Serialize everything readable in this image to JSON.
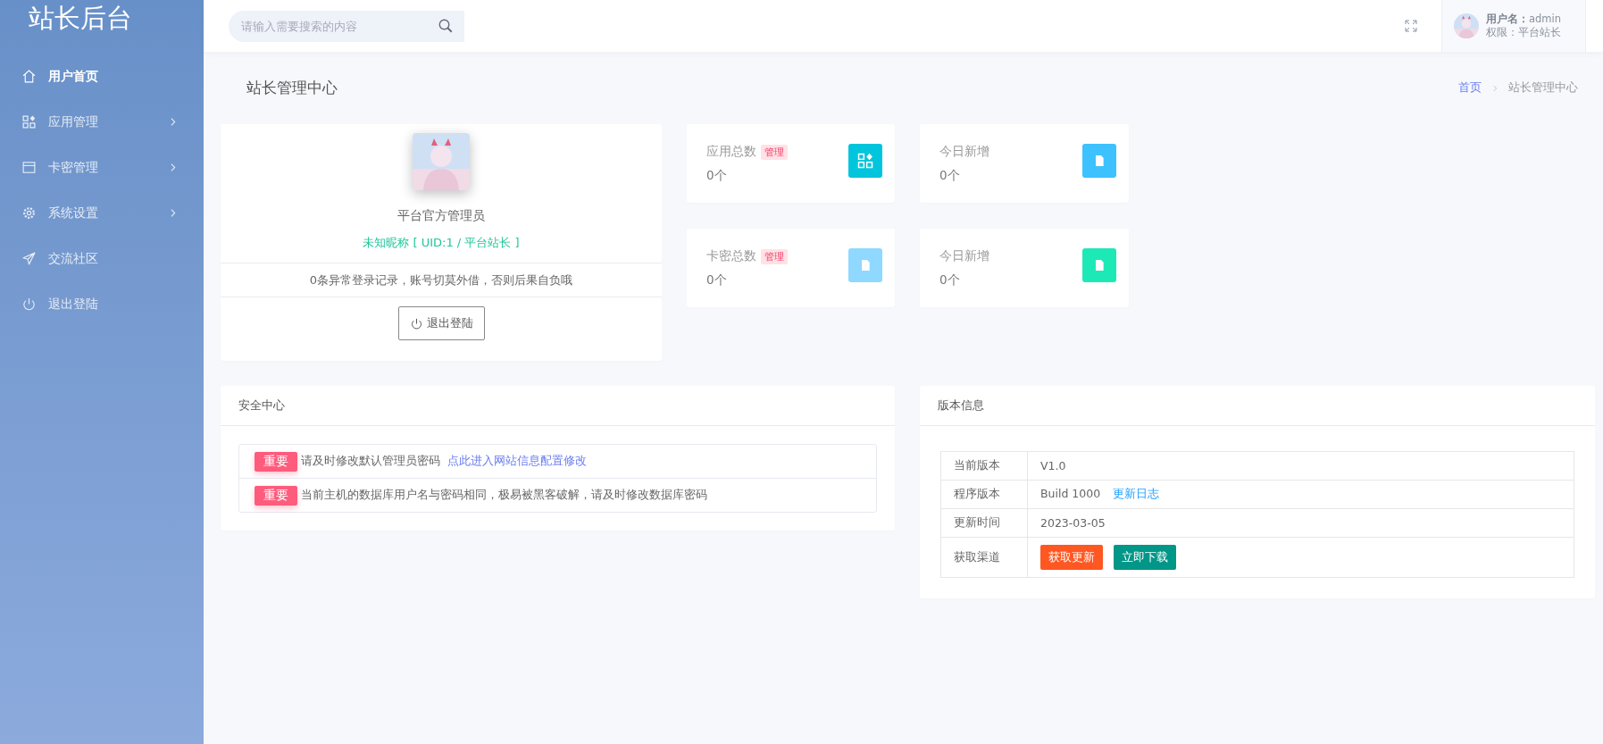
{
  "sidebar": {
    "title": "站长后台",
    "items": [
      {
        "kind": "home",
        "label": "用户首页",
        "selected": true,
        "expandable": false
      },
      {
        "kind": "apps",
        "label": "应用管理",
        "selected": false,
        "expandable": true
      },
      {
        "kind": "card",
        "label": "卡密管理",
        "selected": false,
        "expandable": true
      },
      {
        "kind": "gear",
        "label": "系统设置",
        "selected": false,
        "expandable": true
      },
      {
        "kind": "send",
        "label": "交流社区",
        "selected": false,
        "expandable": false
      },
      {
        "kind": "power",
        "label": "退出登陆",
        "selected": false,
        "expandable": false
      }
    ]
  },
  "header": {
    "search": {
      "placeholder": "请输入需要搜索的内容"
    },
    "user": {
      "name": "**用户名：**admin",
      "role": "权限：平台站长"
    }
  },
  "page": {
    "title": "站长管理中心",
    "breadcrumb": [
      {
        "label": "首页",
        "current": false
      },
      {
        "label": "站长管理中心",
        "current": true
      }
    ]
  },
  "profile": {
    "name": "平台官方管理员",
    "info": "未知昵称 [ UID:1 / 平台站长 ]",
    "notice": "0条异常登录记录，账号切莫外借，否则后果自负哦",
    "button": "退出登陆"
  },
  "stats": [
    {
      "label": "应用总数",
      "badge": "管理",
      "value": "0个",
      "kind": "apps",
      "color": "#00c5dc"
    },
    {
      "label": "今日新增",
      "value": "0个",
      "kind": "doc",
      "color": "#3ec1ff"
    },
    {
      "label": "卡密总数",
      "badge": "管理",
      "value": "0个",
      "kind": "doc",
      "color": "#8fd8ff"
    },
    {
      "label": "今日新增",
      "value": "0个",
      "kind": "doc",
      "color": "#1de9b6"
    }
  ],
  "security": {
    "title": "安全中心",
    "items": [
      {
        "badge": "重要",
        "text": "请及时修改默认管理员密码",
        "link": "点此进入网站信息配置修改"
      },
      {
        "badge": "重要",
        "text": "当前主机的数据库用户名与密码相同，极易被黑客破解，请及时修改数据库密码"
      }
    ]
  },
  "version": {
    "title": "版本信息",
    "rows": [
      {
        "kind": "text",
        "label": "当前版本",
        "value": "V1.0"
      },
      {
        "kind": "text",
        "label": "程序版本",
        "value": "Build 1000",
        "link": "更新日志"
      },
      {
        "kind": "text",
        "label": "更新时间",
        "value": "2023-03-05"
      },
      {
        "kind": "buttons",
        "label": "获取渠道",
        "buttons": [
          {
            "label": "获取更新",
            "color": "#ff5722"
          },
          {
            "label": "立即下载",
            "color": "#009688"
          }
        ]
      }
    ]
  }
}
